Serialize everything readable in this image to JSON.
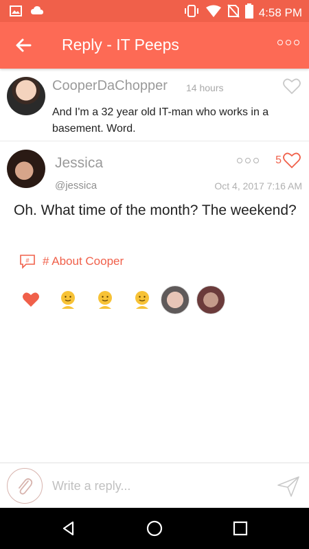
{
  "status": {
    "time": "4:58 PM",
    "icons": [
      "image-icon",
      "cloud-icon",
      "vibrate-icon",
      "wifi-icon",
      "no-sim-icon",
      "battery-icon"
    ]
  },
  "header": {
    "title": "Reply - IT Peeps",
    "back_icon": "arrow-left-icon",
    "more_icon": "more-icon"
  },
  "post1": {
    "author": "CooperDaChopper",
    "time_ago": "14 hours",
    "text": "And I'm a 32 year old IT-man who works in a basement. Word."
  },
  "post2": {
    "author": "Jessica",
    "handle": "@jessica",
    "likes": "5",
    "timestamp": "Oct 4, 2017 7:16 AM",
    "text": "Oh. What time of the month? The weekend?",
    "topic": "# About Cooper",
    "reactions": [
      "heart",
      "smiley",
      "smiley",
      "smiley",
      "avatar",
      "avatar"
    ]
  },
  "compose": {
    "placeholder": "Write a reply..."
  },
  "colors": {
    "primary": "#fd6a55",
    "status_bar": "#f0604a",
    "accent": "#f0604a"
  }
}
